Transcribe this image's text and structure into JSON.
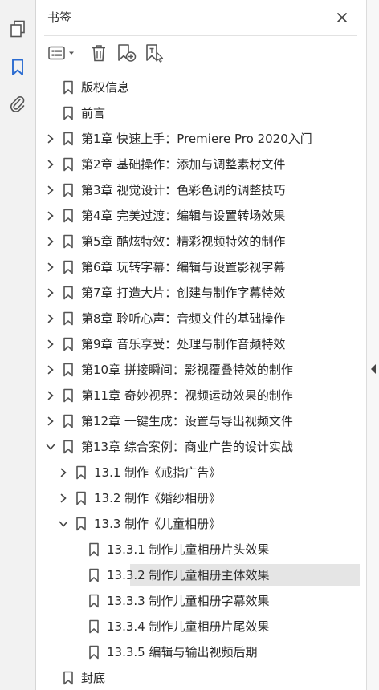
{
  "panel": {
    "title": "书签"
  },
  "tree": [
    {
      "label": "版权信息",
      "level": 0,
      "expand": "none"
    },
    {
      "label": "前言",
      "level": 0,
      "expand": "none"
    },
    {
      "label": "第1章 快速上手：Premiere Pro 2020入门",
      "level": 0,
      "expand": "collapsed"
    },
    {
      "label": "第2章 基础操作：添加与调整素材文件",
      "level": 0,
      "expand": "collapsed"
    },
    {
      "label": "第3章 视觉设计：色彩色调的调整技巧",
      "level": 0,
      "expand": "collapsed"
    },
    {
      "label": "第4章 完美过渡：编辑与设置转场效果",
      "level": 0,
      "expand": "collapsed",
      "underline": true
    },
    {
      "label": "第5章 酷炫特效：精彩视频特效的制作",
      "level": 0,
      "expand": "collapsed"
    },
    {
      "label": "第6章 玩转字幕：编辑与设置影视字幕",
      "level": 0,
      "expand": "collapsed"
    },
    {
      "label": "第7章 打造大片：创建与制作字幕特效",
      "level": 0,
      "expand": "collapsed"
    },
    {
      "label": "第8章 聆听心声：音频文件的基础操作",
      "level": 0,
      "expand": "collapsed"
    },
    {
      "label": "第9章 音乐享受：处理与制作音频特效",
      "level": 0,
      "expand": "collapsed"
    },
    {
      "label": "第10章 拼接瞬间：影视覆叠特效的制作",
      "level": 0,
      "expand": "collapsed"
    },
    {
      "label": "第11章 奇妙视界：视频运动效果的制作",
      "level": 0,
      "expand": "collapsed"
    },
    {
      "label": "第12章 一键生成：设置与导出视频文件",
      "level": 0,
      "expand": "collapsed"
    },
    {
      "label": "第13章 综合案例：商业广告的设计实战",
      "level": 0,
      "expand": "expanded"
    },
    {
      "label": "13.1 制作《戒指广告》",
      "level": 1,
      "expand": "collapsed"
    },
    {
      "label": "13.2 制作《婚纱相册》",
      "level": 1,
      "expand": "collapsed"
    },
    {
      "label": "13.3 制作《儿童相册》",
      "level": 1,
      "expand": "expanded"
    },
    {
      "label": "13.3.1 制作儿童相册片头效果",
      "level": 2,
      "expand": "none"
    },
    {
      "label": "13.3.2 制作儿童相册主体效果",
      "level": 2,
      "expand": "none",
      "selected": true
    },
    {
      "label": "13.3.3 制作儿童相册字幕效果",
      "level": 2,
      "expand": "none"
    },
    {
      "label": "13.3.4 制作儿童相册片尾效果",
      "level": 2,
      "expand": "none"
    },
    {
      "label": "13.3.5 编辑与输出视频后期",
      "level": 2,
      "expand": "none"
    },
    {
      "label": "封底",
      "level": 0,
      "expand": "none"
    }
  ],
  "colors": {
    "accent": "#2a6bd1",
    "icon": "#555555",
    "selected_bg": "#e5e5e5"
  },
  "icons": {
    "rail": [
      "pages-icon",
      "bookmark-icon",
      "attachment-icon"
    ],
    "toolbar": [
      "options-menu-icon",
      "delete-icon",
      "new-bookmark-icon",
      "bookmark-from-selection-icon"
    ]
  }
}
